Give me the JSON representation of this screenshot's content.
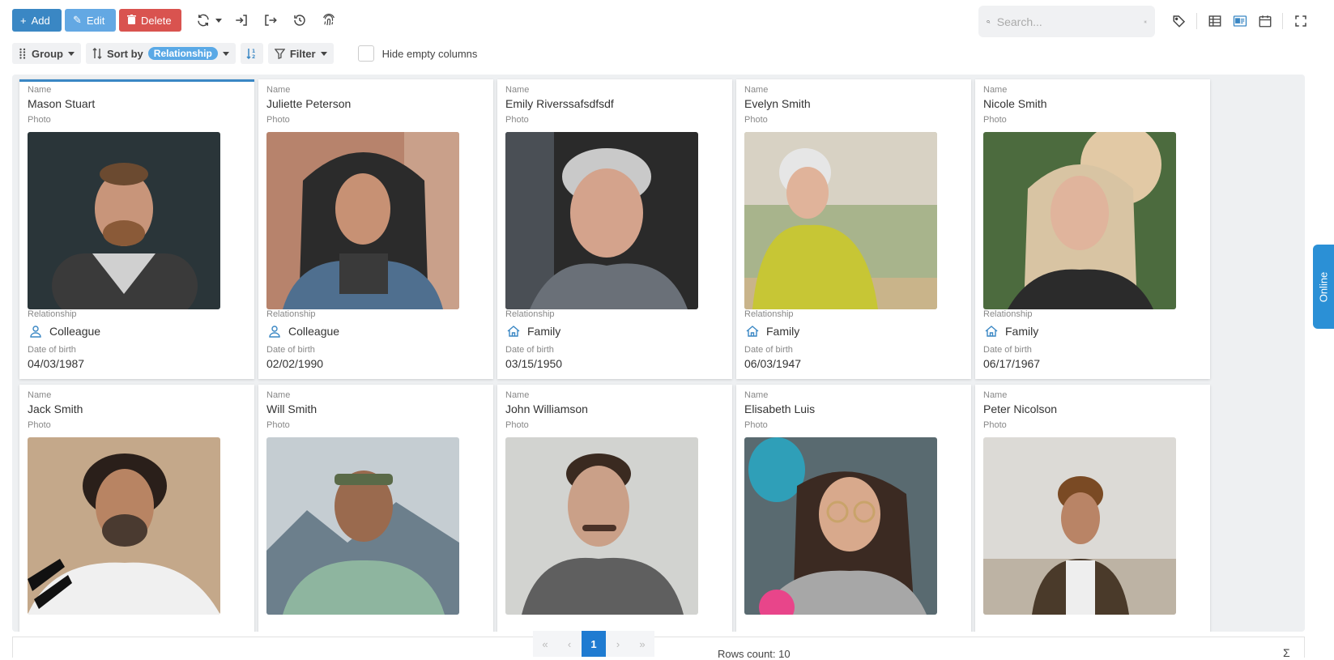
{
  "toolbar": {
    "add_label": "Add",
    "edit_label": "Edit",
    "delete_label": "Delete",
    "search_placeholder": "Search..."
  },
  "controls": {
    "group_label": "Group",
    "sort_label": "Sort by",
    "sort_value": "Relationship",
    "filter_label": "Filter",
    "hide_empty_label": "Hide empty columns"
  },
  "field_labels": {
    "name": "Name",
    "photo": "Photo",
    "relationship": "Relationship",
    "dob": "Date of birth"
  },
  "cards": [
    {
      "name": "Mason Stuart",
      "relationship": "Colleague",
      "rel_icon": "user-icon",
      "dob": "04/03/1987",
      "selected": true
    },
    {
      "name": "Juliette Peterson",
      "relationship": "Colleague",
      "rel_icon": "user-icon",
      "dob": "02/02/1990"
    },
    {
      "name": "Emily Riverssafsdfsdf",
      "relationship": "Family",
      "rel_icon": "home-icon",
      "dob": "03/15/1950"
    },
    {
      "name": "Evelyn Smith",
      "relationship": "Family",
      "rel_icon": "home-icon",
      "dob": "06/03/1947"
    },
    {
      "name": "Nicole Smith",
      "relationship": "Family",
      "rel_icon": "home-icon",
      "dob": "06/17/1967"
    },
    {
      "name": "Jack Smith"
    },
    {
      "name": "Will Smith"
    },
    {
      "name": "John Williamson"
    },
    {
      "name": "Elisabeth Luis"
    },
    {
      "name": "Peter Nicolson"
    }
  ],
  "pager": {
    "current": "1"
  },
  "footer": {
    "rows_count": "Rows count: 10",
    "sigma": "Σ"
  },
  "side_tab": "Online",
  "colors": {
    "primary": "#3a87c4",
    "edit": "#63a8e3",
    "danger": "#d9534f",
    "online": "#2b90d6"
  }
}
